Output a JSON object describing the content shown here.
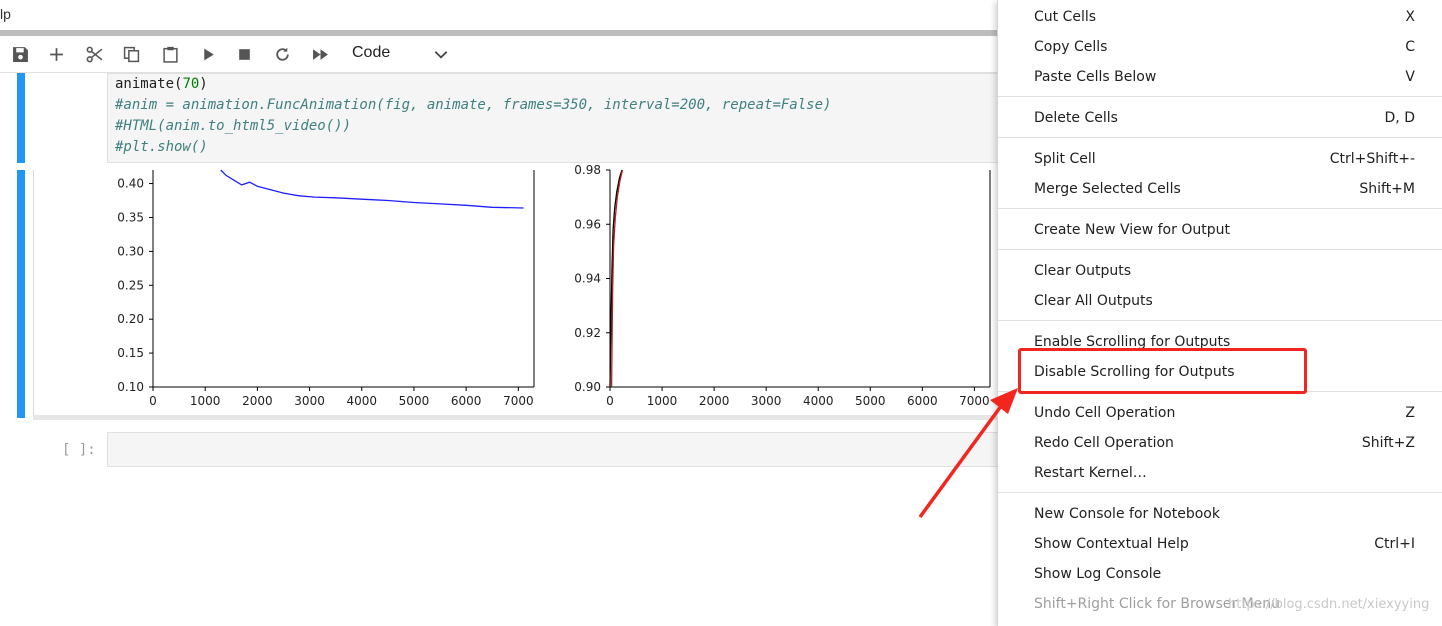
{
  "menubar": {
    "fragment": "lp"
  },
  "toolbar": {
    "buttons": [
      "save-icon",
      "add-icon",
      "cut-icon",
      "copy-icon",
      "paste-icon",
      "run-icon",
      "stop-icon",
      "restart-icon",
      "fast-forward-icon"
    ],
    "cell_type": "Code"
  },
  "code_cell": {
    "lines": {
      "l1_pre": "animate(",
      "l1_num": "70",
      "l1_post": ")",
      "l2": "#anim = animation.FuncAnimation(fig, animate, frames=350, interval=200, repeat=False)",
      "l3": "#HTML(anim.to_html5_video())",
      "l4": "#plt.show()"
    }
  },
  "chart_data": [
    {
      "type": "line",
      "title": "",
      "xlabel": "",
      "ylabel": "",
      "xlim": [
        0,
        7300
      ],
      "ylim": [
        0.1,
        0.42
      ],
      "x_ticks": [
        0,
        1000,
        2000,
        3000,
        4000,
        5000,
        6000,
        7000
      ],
      "y_ticks": [
        0.1,
        0.15,
        0.2,
        0.25,
        0.3,
        0.35,
        0.4
      ],
      "series": [
        {
          "color": "#1f1fff",
          "x": [
            1300,
            1400,
            1550,
            1700,
            1850,
            2000,
            2200,
            2500,
            2800,
            3100,
            3500,
            4000,
            4500,
            5000,
            5500,
            6000,
            6500,
            7100
          ],
          "y": [
            0.422,
            0.412,
            0.405,
            0.398,
            0.402,
            0.396,
            0.392,
            0.386,
            0.382,
            0.38,
            0.379,
            0.377,
            0.375,
            0.372,
            0.37,
            0.368,
            0.365,
            0.364
          ]
        }
      ]
    },
    {
      "type": "line",
      "title": "",
      "xlabel": "",
      "ylabel": "",
      "xlim": [
        0,
        7300
      ],
      "ylim": [
        0.9,
        0.98
      ],
      "x_ticks": [
        0,
        1000,
        2000,
        3000,
        4000,
        5000,
        6000,
        7000
      ],
      "y_ticks": [
        0.9,
        0.92,
        0.94,
        0.96,
        0.98
      ],
      "series": [
        {
          "color": "#000000",
          "x": [
            0,
            20,
            40,
            60,
            90,
            130,
            180,
            230
          ],
          "y": [
            0.9,
            0.925,
            0.945,
            0.958,
            0.966,
            0.972,
            0.977,
            0.98
          ]
        },
        {
          "color": "#b22222",
          "x": [
            30,
            50,
            70,
            100,
            140,
            190,
            240
          ],
          "y": [
            0.9,
            0.935,
            0.952,
            0.962,
            0.97,
            0.976,
            0.98
          ]
        }
      ]
    }
  ],
  "empty_cell": {
    "prompt": "[ ]:"
  },
  "context_menu": {
    "items": [
      {
        "label": "Cut Cells",
        "shortcut": "X"
      },
      {
        "label": "Copy Cells",
        "shortcut": "C"
      },
      {
        "label": "Paste Cells Below",
        "shortcut": "V"
      },
      {
        "label": "Delete Cells",
        "shortcut": "D, D"
      },
      {
        "label": "Split Cell",
        "shortcut": "Ctrl+Shift+-"
      },
      {
        "label": "Merge Selected Cells",
        "shortcut": "Shift+M"
      },
      {
        "label": "Create New View for Output",
        "shortcut": ""
      },
      {
        "label": "Clear Outputs",
        "shortcut": ""
      },
      {
        "label": "Clear All Outputs",
        "shortcut": ""
      },
      {
        "label": "Enable Scrolling for Outputs",
        "shortcut": ""
      },
      {
        "label": "Disable Scrolling for Outputs",
        "shortcut": ""
      },
      {
        "label": "Undo Cell Operation",
        "shortcut": "Z"
      },
      {
        "label": "Redo Cell Operation",
        "shortcut": "Shift+Z"
      },
      {
        "label": "Restart Kernel…",
        "shortcut": ""
      },
      {
        "label": "New Console for Notebook",
        "shortcut": ""
      },
      {
        "label": "Show Contextual Help",
        "shortcut": "Ctrl+I"
      },
      {
        "label": "Show Log Console",
        "shortcut": ""
      },
      {
        "label": "Shift+Right Click for Browser Menu",
        "shortcut": ""
      }
    ]
  },
  "annotation": {
    "highlight_color": "#f2261e"
  },
  "watermark": "https://blog.csdn.net/xiexyying"
}
